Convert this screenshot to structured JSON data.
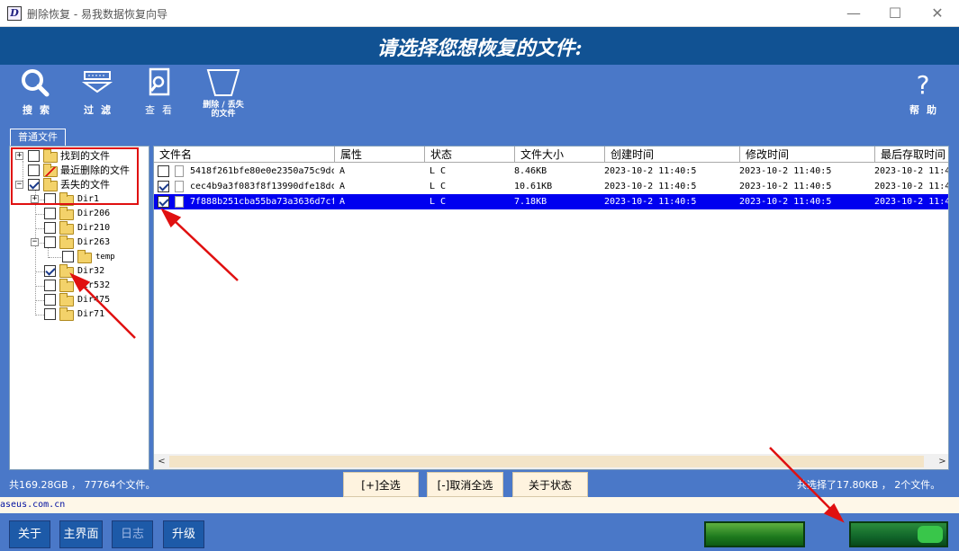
{
  "window": {
    "title": "删除恢复 - 易我数据恢复向导",
    "icon_letter": "D",
    "controls": {
      "minimize": "—",
      "maximize": "☐",
      "close": "✕"
    }
  },
  "header": {
    "heading": "请选择您想恢复的文件:"
  },
  "toolbar": {
    "search": "搜索",
    "filter": "过滤",
    "view": "查看",
    "deleted": "删除 / 丢失\n的文件",
    "help": "帮助"
  },
  "tabs": {
    "normal": "普通文件"
  },
  "tree": [
    {
      "label": "找到的文件",
      "checked": false,
      "expander": "+"
    },
    {
      "label": "最近删除的文件",
      "checked": false,
      "expander": ""
    },
    {
      "label": "丢失的文件",
      "checked": true,
      "expander": "−"
    },
    {
      "label": "Dir1",
      "checked": false,
      "expander": "+"
    },
    {
      "label": "Dir206",
      "checked": false,
      "expander": ""
    },
    {
      "label": "Dir210",
      "checked": false,
      "expander": ""
    },
    {
      "label": "Dir263",
      "checked": false,
      "expander": "−"
    },
    {
      "label": "temp",
      "checked": false,
      "expander": ""
    },
    {
      "label": "Dir32",
      "checked": true,
      "expander": ""
    },
    {
      "label": "Dir532",
      "checked": false,
      "expander": ""
    },
    {
      "label": "Dir475",
      "checked": false,
      "expander": ""
    },
    {
      "label": "Dir71",
      "checked": false,
      "expander": ""
    }
  ],
  "columns": [
    "文件名",
    "属性",
    "状态",
    "文件大小",
    "创建时间",
    "修改时间",
    "最后存取时间"
  ],
  "files": [
    {
      "name": "5418f261bfe80e0e2350a75c9dc",
      "attr": "A",
      "status": "L C",
      "size": "8.46KB",
      "created": "2023-10-2 11:40:5",
      "modified": "2023-10-2 11:40:5",
      "accessed": "2023-10-2 11:4",
      "checked": false,
      "selected": false
    },
    {
      "name": "cec4b9a3f083f8f13990dfe18dc",
      "attr": "A",
      "status": "L C",
      "size": "10.61KB",
      "created": "2023-10-2 11:40:5",
      "modified": "2023-10-2 11:40:5",
      "accessed": "2023-10-2 11:4",
      "checked": true,
      "selected": false
    },
    {
      "name": "7f888b251cba55ba73a3636d7cf",
      "attr": "A",
      "status": "L C",
      "size": "7.18KB",
      "created": "2023-10-2 11:40:5",
      "modified": "2023-10-2 11:40:5",
      "accessed": "2023-10-2 11:4",
      "checked": true,
      "selected": true
    }
  ],
  "status": {
    "left": "共169.28GB ， 77764个文件。",
    "right": "共选择了17.80KB ， 2个文件。",
    "select_all": "[+]全选",
    "deselect_all": "[-]取消全选",
    "about_status": "关于状态"
  },
  "link": "aseus.com.cn",
  "bottom": {
    "about": "关于",
    "main": "主界面",
    "log": "日志",
    "upgrade": "升级"
  },
  "colors": {
    "panel": "#4a78c8",
    "header": "#115293",
    "selection": "#0000f0",
    "annotation": "#e01010"
  }
}
